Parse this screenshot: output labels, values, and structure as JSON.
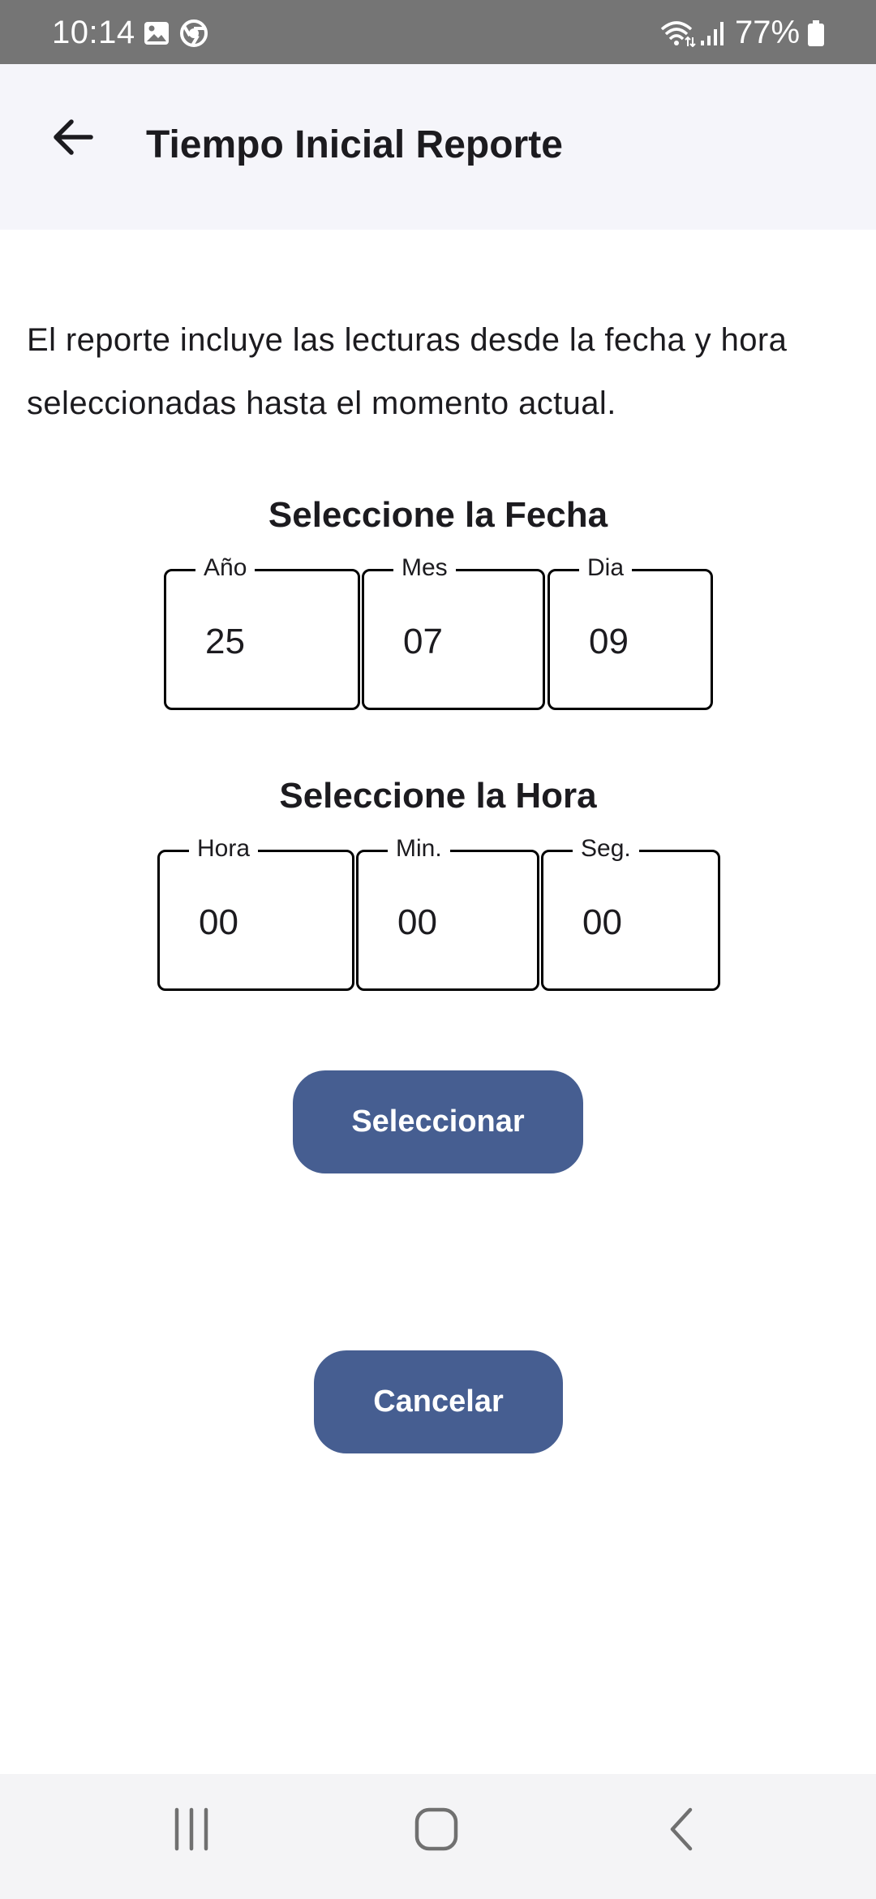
{
  "status_bar": {
    "time": "10:14",
    "battery": "77%",
    "icons": [
      "image-icon",
      "chrome-icon",
      "wifi-icon",
      "signal-icon",
      "battery-icon"
    ]
  },
  "app_bar": {
    "title": "Tiempo Inicial Reporte",
    "back_icon": "arrow-back-icon"
  },
  "content": {
    "description": "El reporte incluye las lecturas desde la fecha y hora seleccionadas hasta el momento actual.",
    "date_section": {
      "title": "Seleccione la Fecha",
      "fields": [
        {
          "label": "Año",
          "value": "25"
        },
        {
          "label": "Mes",
          "value": "07"
        },
        {
          "label": "Dia",
          "value": "09"
        }
      ]
    },
    "time_section": {
      "title": "Seleccione la Hora",
      "fields": [
        {
          "label": "Hora",
          "value": "00"
        },
        {
          "label": "Min.",
          "value": "00"
        },
        {
          "label": "Seg.",
          "value": "00"
        }
      ]
    },
    "select_button": "Seleccionar",
    "cancel_button": "Cancelar"
  },
  "nav_bar": {
    "icons": [
      "recent-apps-icon",
      "home-icon",
      "back-icon"
    ]
  },
  "colors": {
    "status_bar": "#757575",
    "app_bar": "#f5f5fa",
    "button": "#465e91",
    "nav_bar": "#f4f4f6"
  }
}
